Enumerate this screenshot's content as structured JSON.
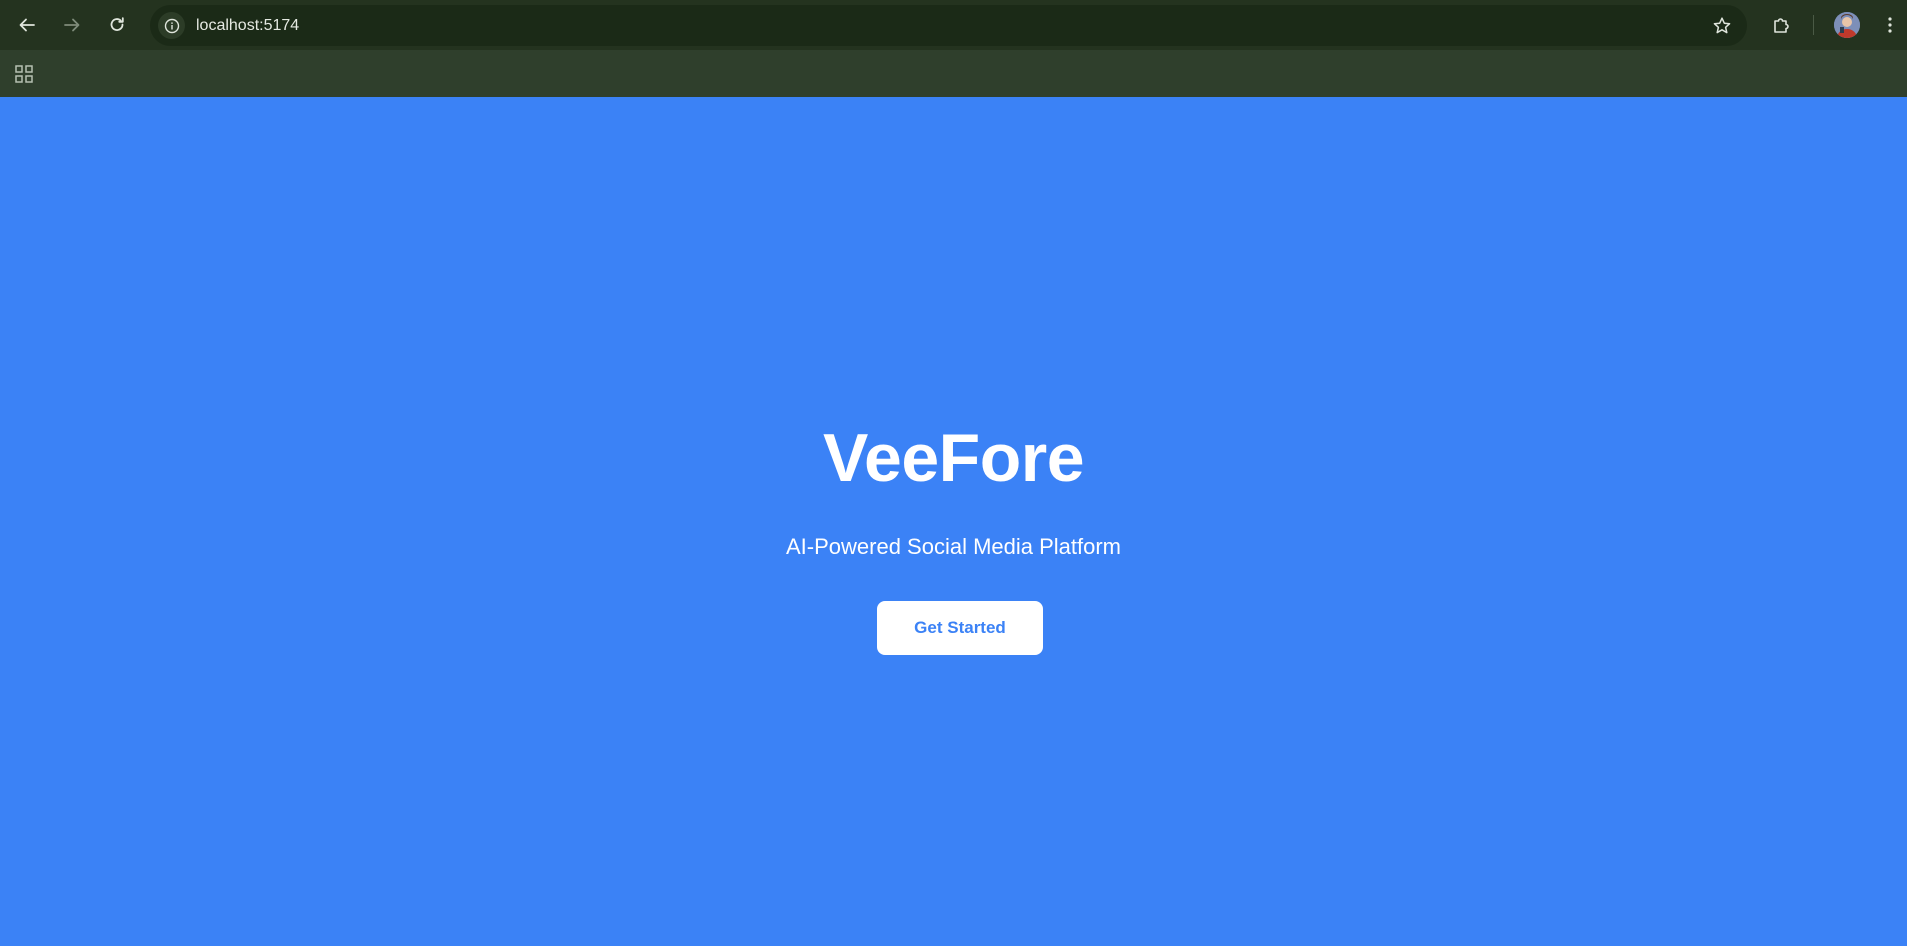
{
  "browser": {
    "url": "localhost:5174",
    "icons": {
      "back": "back-arrow-icon",
      "forward": "forward-arrow-icon",
      "reload": "reload-icon",
      "site_info": "info-icon",
      "bookmark": "star-icon",
      "extensions": "puzzle-icon",
      "profile": "avatar",
      "menu": "kebab-menu-icon",
      "apps": "apps-grid-icon"
    },
    "colors": {
      "toolbar": "#24331f",
      "omnibox": "#1b2a17",
      "bookmarks_bar": "#2f3f2c"
    }
  },
  "page": {
    "title": "VeeFore",
    "subtitle": "AI-Powered Social Media Platform",
    "cta_label": "Get Started",
    "colors": {
      "background": "#3b82f6",
      "title": "#ffffff",
      "cta_background": "#ffffff",
      "cta_text": "#3b82f6"
    }
  }
}
